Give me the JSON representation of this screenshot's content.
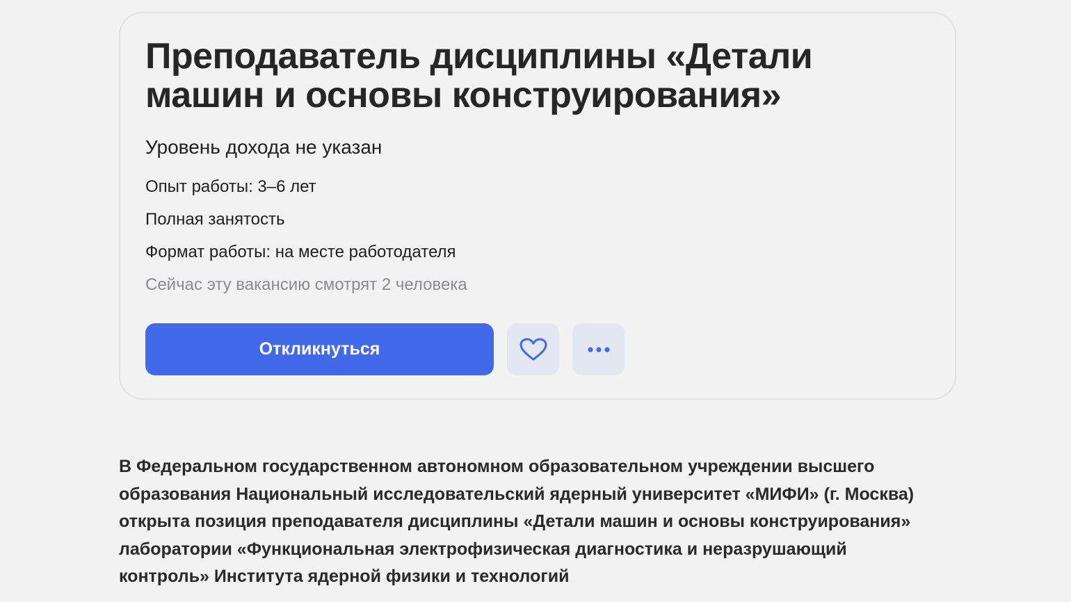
{
  "vacancy": {
    "title": "Преподаватель дисциплины «Детали машин и основы конструирования»",
    "salary": "Уровень дохода не указан",
    "experience": "Опыт работы: 3–6 лет",
    "employment": "Полная занятость",
    "work_format": "Формат работы: на месте работодателя",
    "viewers": "Сейчас эту вакансию смотрят 2 человека"
  },
  "actions": {
    "apply_label": "Откликнуться",
    "favorite_icon": "heart-icon",
    "more_icon": "more-dots-icon",
    "accent_color": "#4169e8",
    "secondary_bg": "#e2e7f1"
  },
  "description": {
    "text": "В Федеральном государственном автономном образовательном учреждении высшего образования Национальный исследовательский ядерный университет «МИФИ» (г. Москва) открыта позиция преподавателя дисциплины «Детали машин и основы конструирования» лаборатории «Функциональная электрофизическая диагностика и неразрушающий контроль» Института ядерной физики и технологий"
  }
}
